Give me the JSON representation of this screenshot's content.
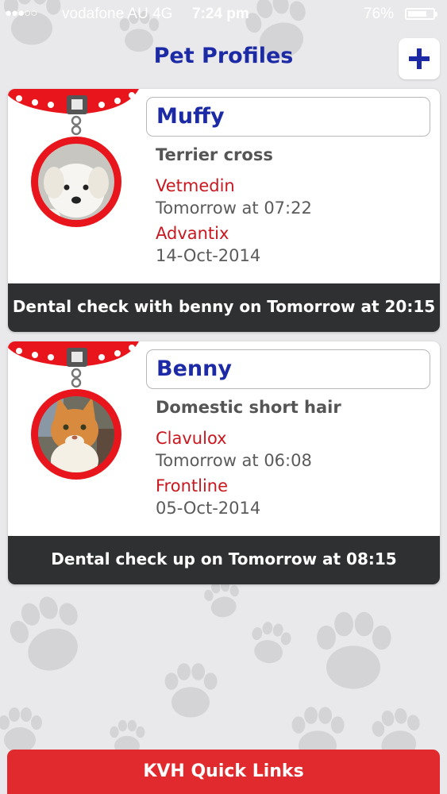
{
  "status_bar": {
    "signal": "●●●○○",
    "carrier": "vodafone AU  4G",
    "time": "7:24 pm",
    "battery_percent": "76%",
    "battery_level": 0.76
  },
  "header": {
    "title": "Pet Profiles",
    "add_icon": "plus-icon"
  },
  "pets": [
    {
      "name": "Muffy",
      "breed": "Terrier cross",
      "medications": [
        {
          "name": "Vetmedin",
          "time": "Tomorrow at 07:22"
        },
        {
          "name": "Advantix",
          "time": "14-Oct-2014"
        }
      ],
      "reminder": "Dental check with benny on Tomorrow at 20:15"
    },
    {
      "name": "Benny",
      "breed": "Domestic short hair",
      "medications": [
        {
          "name": "Clavulox",
          "time": "Tomorrow at 06:08"
        },
        {
          "name": "Frontline",
          "time": "05-Oct-2014"
        }
      ],
      "reminder": "Dental check up on Tomorrow at 08:15"
    }
  ],
  "footer": {
    "quick_links_label": "KVH Quick Links"
  },
  "colors": {
    "title_blue": "#1c2aa6",
    "medication_red": "#c9181f",
    "collar_red": "#e8161c",
    "reminder_bar": "#2f3032",
    "quick_links_red": "#e02a2d"
  }
}
